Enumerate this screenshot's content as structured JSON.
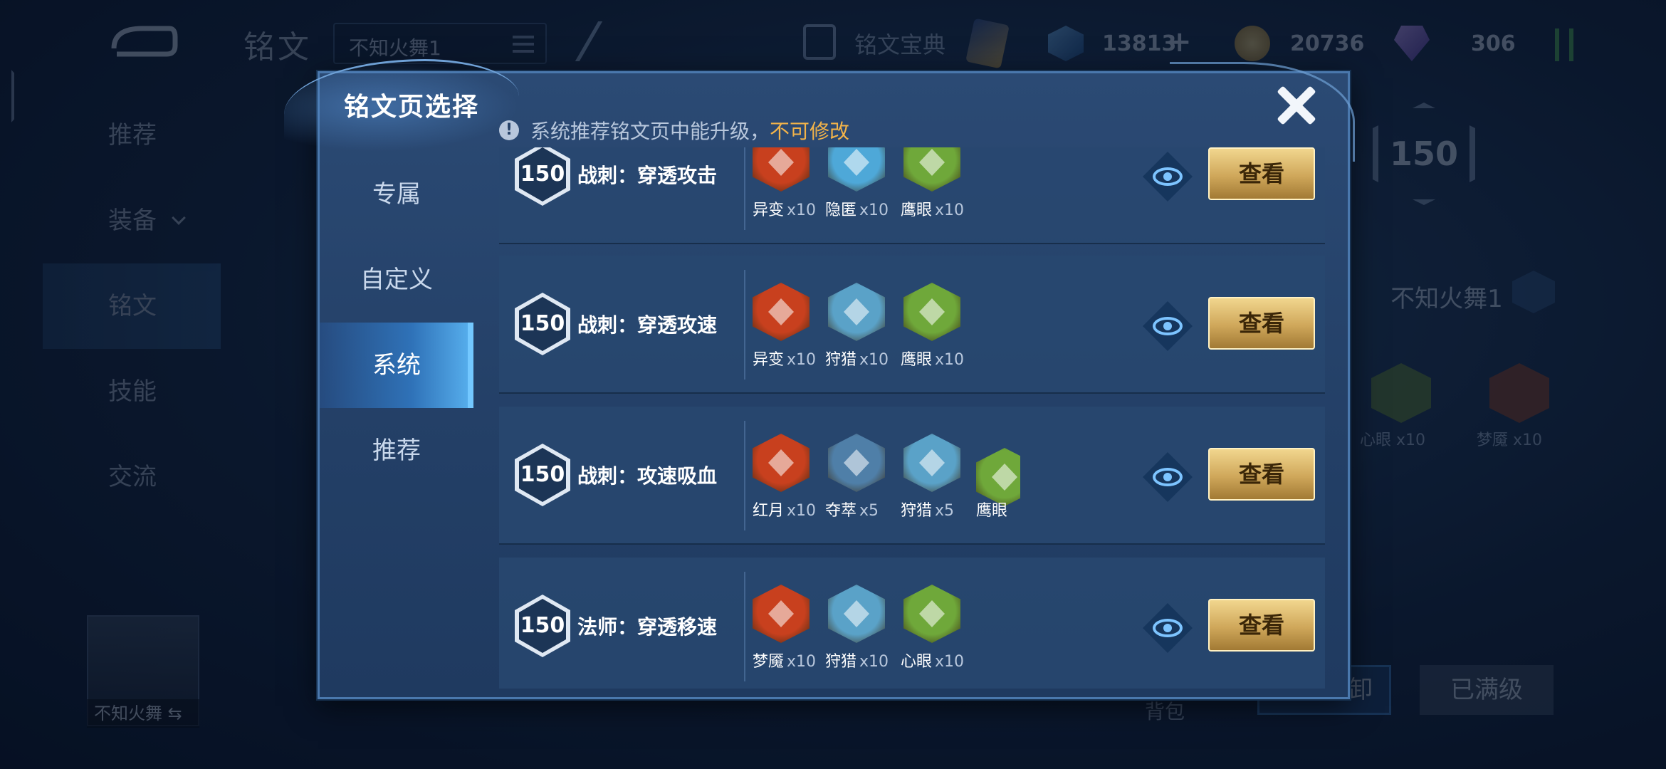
{
  "background": {
    "page_title": "铭文",
    "page_select_value": "不知火舞1",
    "codex_label": "铭文宝典",
    "currency": {
      "gems": "13813",
      "coins": "20736",
      "crystals": "306"
    },
    "side_nav": [
      {
        "label": "推荐"
      },
      {
        "label": "装备"
      },
      {
        "label": "铭文"
      },
      {
        "label": "技能"
      },
      {
        "label": "交流"
      }
    ],
    "hero_name": "不知火舞",
    "right_panel": {
      "level": "150",
      "page_name": "不知火舞1",
      "runes": [
        {
          "name": "心眼",
          "count": "x10"
        },
        {
          "name": "梦魇",
          "count": "x10"
        }
      ],
      "bag_label": "背包",
      "unload_label": "一键拆卸",
      "maxed_label": "已满级"
    }
  },
  "modal": {
    "title": "铭文页选择",
    "notice_text": "系统推荐铭文页中能升级，",
    "notice_warn": "不可修改",
    "tabs": [
      {
        "label": "专属",
        "active": false
      },
      {
        "label": "自定义",
        "active": false
      },
      {
        "label": "系统",
        "active": true
      },
      {
        "label": "推荐",
        "active": false
      }
    ],
    "view_label": "查看",
    "pages": [
      {
        "level": "150",
        "name": "战刺：穿透攻击",
        "runes": [
          {
            "name": "异变",
            "count": "x10",
            "color": "#c8401e"
          },
          {
            "name": "隐匿",
            "count": "x10",
            "color": "#4ea8d8"
          },
          {
            "name": "鹰眼",
            "count": "x10",
            "color": "#6fa83a"
          }
        ]
      },
      {
        "level": "150",
        "name": "战刺：穿透攻速",
        "runes": [
          {
            "name": "异变",
            "count": "x10",
            "color": "#c8401e"
          },
          {
            "name": "狩猎",
            "count": "x10",
            "color": "#5aa2c8"
          },
          {
            "name": "鹰眼",
            "count": "x10",
            "color": "#6fa83a"
          }
        ]
      },
      {
        "level": "150",
        "name": "战刺：攻速吸血",
        "runes": [
          {
            "name": "红月",
            "count": "x10",
            "color": "#c8401e"
          },
          {
            "name": "夺萃",
            "count": "x5",
            "color": "#4f7fa8"
          },
          {
            "name": "狩猎",
            "count": "x5",
            "color": "#5aa2c8"
          },
          {
            "name": "鹰眼",
            "count": "",
            "color": "#6fa83a"
          }
        ]
      },
      {
        "level": "150",
        "name": "法师：穿透移速",
        "runes": [
          {
            "name": "梦魇",
            "count": "x10",
            "color": "#c8401e"
          },
          {
            "name": "狩猎",
            "count": "x10",
            "color": "#5aa2c8"
          },
          {
            "name": "心眼",
            "count": "x10",
            "color": "#6fa83a"
          }
        ]
      }
    ]
  }
}
